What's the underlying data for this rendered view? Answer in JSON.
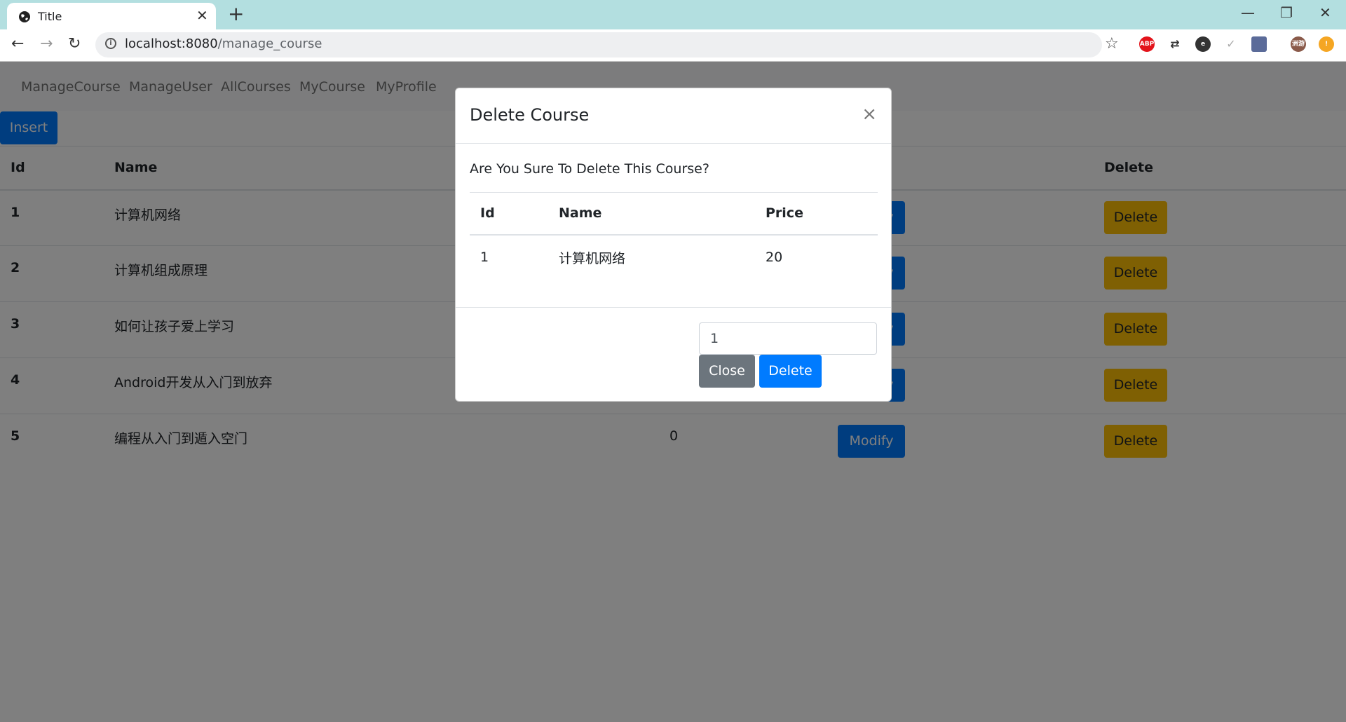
{
  "browser": {
    "tab_title": "Title",
    "url_host": "localhost:8080",
    "url_path": "/manage_course",
    "extension_abp_label": "ABP",
    "extension_avatar_label": "洲游"
  },
  "navbar": {
    "items": [
      "ManageCourse",
      "ManageUser",
      "AllCourses",
      "MyCourse",
      "MyProfile"
    ]
  },
  "insert_label": "Insert",
  "table": {
    "headers": {
      "id": "Id",
      "name": "Name",
      "delete": "Delete"
    },
    "modify_label": "Modify",
    "delete_label": "Delete",
    "rows": [
      {
        "id": "1",
        "name": "计算机网络",
        "price": ""
      },
      {
        "id": "2",
        "name": "计算机组成原理",
        "price": ""
      },
      {
        "id": "3",
        "name": "如何让孩子爱上学习",
        "price": ""
      },
      {
        "id": "4",
        "name": "Android开发从入门到放弃",
        "price": ""
      },
      {
        "id": "5",
        "name": "编程从入门到遁入空门",
        "price": "0"
      }
    ]
  },
  "modal": {
    "title": "Delete Course",
    "close_symbol": "×",
    "message": "Are You Sure To Delete This Course?",
    "headers": {
      "id": "Id",
      "name": "Name",
      "price": "Price"
    },
    "row": {
      "id": "1",
      "name": "计算机网络",
      "price": "20"
    },
    "input_value": "1",
    "close_label": "Close",
    "delete_label": "Delete"
  }
}
